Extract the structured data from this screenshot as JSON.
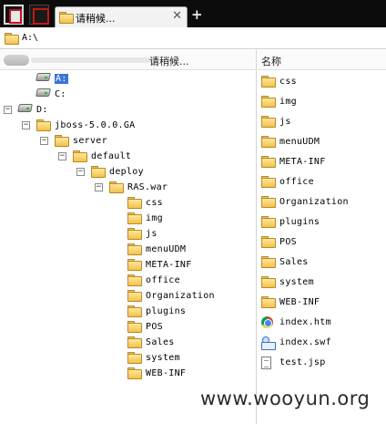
{
  "tab": {
    "title": "请稍候..."
  },
  "address": {
    "path": "A:\\"
  },
  "left_pane": {
    "column_title": "请稍候..."
  },
  "right_pane": {
    "column_title": "名称"
  },
  "tree": [
    {
      "label": "A:",
      "icon": "drive-icon",
      "toggle": "",
      "selected": true
    },
    {
      "label": "C:",
      "icon": "drive-icon",
      "toggle": ""
    },
    {
      "label": "D:",
      "icon": "drive-icon",
      "toggle": "−"
    },
    {
      "label": "jboss-5.0.0.GA",
      "icon": "folder-icon",
      "toggle": "−"
    },
    {
      "label": "server",
      "icon": "folder-icon",
      "toggle": "−"
    },
    {
      "label": "default",
      "icon": "folder-icon",
      "toggle": "−"
    },
    {
      "label": "deploy",
      "icon": "folder-icon",
      "toggle": "−"
    },
    {
      "label": "RAS.war",
      "icon": "folder-icon",
      "toggle": "−"
    },
    {
      "label": "css",
      "icon": "folder-icon",
      "toggle": ""
    },
    {
      "label": "img",
      "icon": "folder-icon",
      "toggle": ""
    },
    {
      "label": "js",
      "icon": "folder-icon",
      "toggle": ""
    },
    {
      "label": "menuUDM",
      "icon": "folder-icon",
      "toggle": ""
    },
    {
      "label": "META-INF",
      "icon": "folder-icon",
      "toggle": ""
    },
    {
      "label": "office",
      "icon": "folder-icon",
      "toggle": ""
    },
    {
      "label": "Organization",
      "icon": "folder-icon",
      "toggle": ""
    },
    {
      "label": "plugins",
      "icon": "folder-icon",
      "toggle": ""
    },
    {
      "label": "POS",
      "icon": "folder-icon",
      "toggle": ""
    },
    {
      "label": "Sales",
      "icon": "folder-icon",
      "toggle": ""
    },
    {
      "label": "system",
      "icon": "folder-icon",
      "toggle": ""
    },
    {
      "label": "WEB-INF",
      "icon": "folder-icon",
      "toggle": ""
    }
  ],
  "files": [
    {
      "name": "css",
      "icon": "folder-icon"
    },
    {
      "name": "img",
      "icon": "folder-icon"
    },
    {
      "name": "js",
      "icon": "folder-icon"
    },
    {
      "name": "menuUDM",
      "icon": "folder-icon"
    },
    {
      "name": "META-INF",
      "icon": "folder-icon"
    },
    {
      "name": "office",
      "icon": "folder-icon"
    },
    {
      "name": "Organization",
      "icon": "folder-icon"
    },
    {
      "name": "plugins",
      "icon": "folder-icon"
    },
    {
      "name": "POS",
      "icon": "folder-icon"
    },
    {
      "name": "Sales",
      "icon": "folder-icon"
    },
    {
      "name": "system",
      "icon": "folder-icon"
    },
    {
      "name": "WEB-INF",
      "icon": "folder-icon"
    },
    {
      "name": "index.htm",
      "icon": "chrome-icon"
    },
    {
      "name": "index.swf",
      "icon": "swf-icon"
    },
    {
      "name": "test.jsp",
      "icon": "jsp-file-icon"
    }
  ],
  "watermark": {
    "text": "www.wooyun.org"
  },
  "colors": {
    "tabbar": "#0c0c0c",
    "selection": "#3b75d9",
    "folder": "#f2c24e"
  }
}
